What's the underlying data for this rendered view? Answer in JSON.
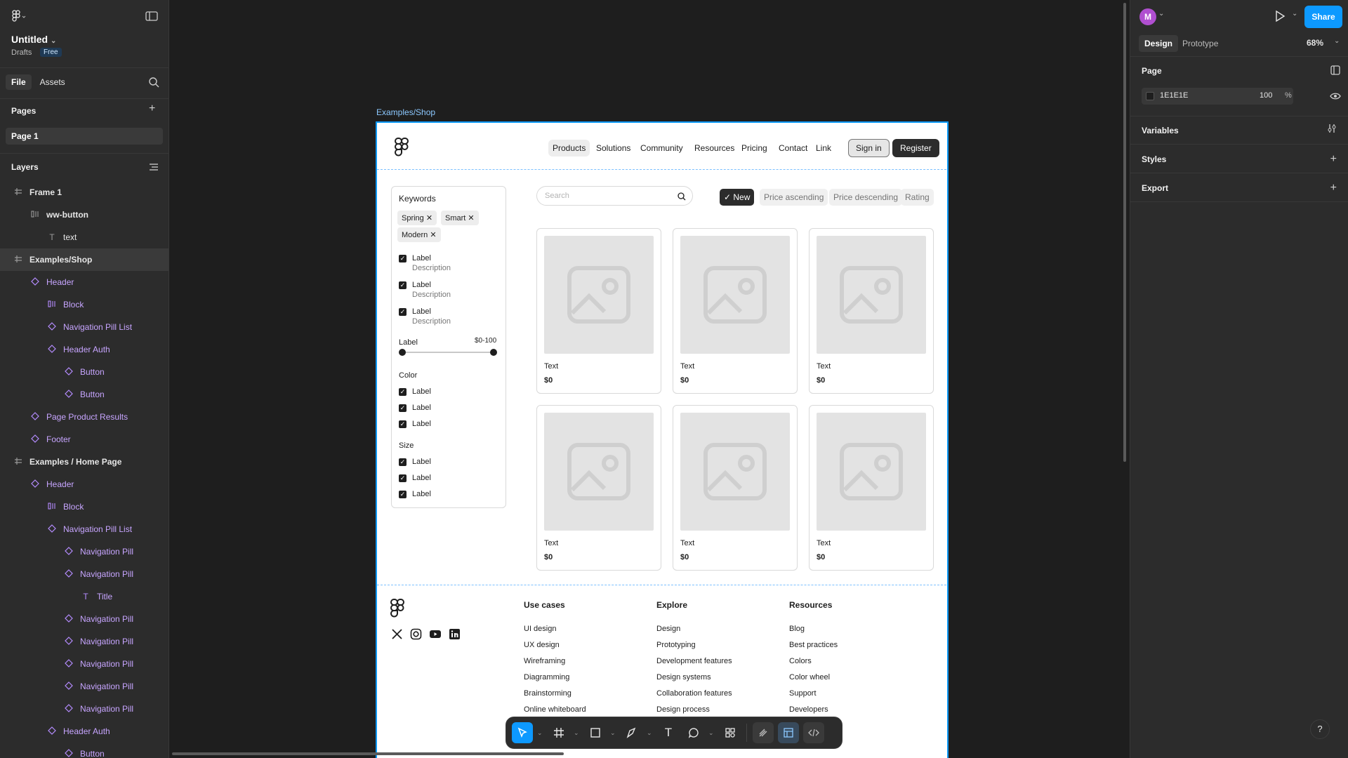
{
  "app": {
    "file_title": "Untitled",
    "drafts_label": "Drafts",
    "plan_badge": "Free",
    "panel_tabs": [
      "File",
      "Assets"
    ],
    "pages_header": "Pages",
    "current_page": "Page 1",
    "layers_header": "Layers"
  },
  "layers": [
    {
      "label": "Frame 1",
      "indent": 0,
      "icon": "frame-icon",
      "purple": false,
      "bold": true
    },
    {
      "label": "ww-button",
      "indent": 1,
      "icon": "auto-layout-icon",
      "purple": false,
      "bold": true
    },
    {
      "label": "text",
      "indent": 2,
      "icon": "text-icon",
      "purple": false,
      "bold": false
    },
    {
      "label": "Examples/Shop",
      "indent": 0,
      "icon": "frame-icon",
      "purple": false,
      "bold": true,
      "selected": true
    },
    {
      "label": "Header",
      "indent": 1,
      "icon": "instance-icon",
      "purple": true,
      "bold": false
    },
    {
      "label": "Block",
      "indent": 2,
      "icon": "auto-layout-icon",
      "purple": true,
      "bold": false
    },
    {
      "label": "Navigation Pill List",
      "indent": 2,
      "icon": "instance-icon",
      "purple": true,
      "bold": false
    },
    {
      "label": "Header Auth",
      "indent": 2,
      "icon": "instance-icon",
      "purple": true,
      "bold": false
    },
    {
      "label": "Button",
      "indent": 3,
      "icon": "instance-icon",
      "purple": true,
      "bold": false
    },
    {
      "label": "Button",
      "indent": 3,
      "icon": "instance-icon",
      "purple": true,
      "bold": false
    },
    {
      "label": "Page Product Results",
      "indent": 1,
      "icon": "instance-icon",
      "purple": true,
      "bold": false
    },
    {
      "label": "Footer",
      "indent": 1,
      "icon": "instance-icon",
      "purple": true,
      "bold": false
    },
    {
      "label": "Examples / Home Page",
      "indent": 0,
      "icon": "frame-icon",
      "purple": false,
      "bold": true
    },
    {
      "label": "Header",
      "indent": 1,
      "icon": "instance-icon",
      "purple": true,
      "bold": false
    },
    {
      "label": "Block",
      "indent": 2,
      "icon": "auto-layout-icon",
      "purple": true,
      "bold": false
    },
    {
      "label": "Navigation Pill List",
      "indent": 2,
      "icon": "instance-icon",
      "purple": true,
      "bold": false
    },
    {
      "label": "Navigation Pill",
      "indent": 3,
      "icon": "instance-icon",
      "purple": true,
      "bold": false
    },
    {
      "label": "Navigation Pill",
      "indent": 3,
      "icon": "instance-icon",
      "purple": true,
      "bold": false
    },
    {
      "label": "Title",
      "indent": 4,
      "icon": "text-icon",
      "purple": true,
      "bold": false
    },
    {
      "label": "Navigation Pill",
      "indent": 3,
      "icon": "instance-icon",
      "purple": true,
      "bold": false
    },
    {
      "label": "Navigation Pill",
      "indent": 3,
      "icon": "instance-icon",
      "purple": true,
      "bold": false
    },
    {
      "label": "Navigation Pill",
      "indent": 3,
      "icon": "instance-icon",
      "purple": true,
      "bold": false
    },
    {
      "label": "Navigation Pill",
      "indent": 3,
      "icon": "instance-icon",
      "purple": true,
      "bold": false
    },
    {
      "label": "Navigation Pill",
      "indent": 3,
      "icon": "instance-icon",
      "purple": true,
      "bold": false
    },
    {
      "label": "Header Auth",
      "indent": 2,
      "icon": "instance-icon",
      "purple": true,
      "bold": false
    },
    {
      "label": "Button",
      "indent": 3,
      "icon": "instance-icon",
      "purple": true,
      "bold": false
    }
  ],
  "right_panel": {
    "avatar_letter": "M",
    "share_label": "Share",
    "tabs": [
      "Design",
      "Prototype"
    ],
    "zoom": "68%",
    "page_section": "Page",
    "page_color_hex": "1E1E1E",
    "page_opacity": "100",
    "percent_sign": "%",
    "variables": "Variables",
    "styles": "Styles",
    "export": "Export"
  },
  "canvas": {
    "frame_label": "Examples/Shop",
    "nav": [
      "Products",
      "Solutions",
      "Community",
      "Resources",
      "Pricing",
      "Contact",
      "Link"
    ],
    "sign_in": "Sign in",
    "register": "Register",
    "filters": {
      "keywords_title": "Keywords",
      "tags": [
        "Spring",
        "Smart",
        "Modern"
      ],
      "checks": [
        {
          "label": "Label",
          "desc": "Description"
        },
        {
          "label": "Label",
          "desc": "Description"
        },
        {
          "label": "Label",
          "desc": "Description"
        }
      ],
      "range_label": "Label",
      "range_value": "$0-100",
      "color_title": "Color",
      "color_items": [
        "Label",
        "Label",
        "Label"
      ],
      "size_title": "Size",
      "size_items": [
        "Label",
        "Label",
        "Label"
      ]
    },
    "search_placeholder": "Search",
    "sort": [
      "New",
      "Price ascending",
      "Price descending",
      "Rating"
    ],
    "products": [
      {
        "title": "Text",
        "price": "$0"
      },
      {
        "title": "Text",
        "price": "$0"
      },
      {
        "title": "Text",
        "price": "$0"
      },
      {
        "title": "Text",
        "price": "$0"
      },
      {
        "title": "Text",
        "price": "$0"
      },
      {
        "title": "Text",
        "price": "$0"
      }
    ],
    "footer": {
      "cols": [
        {
          "title": "Use cases",
          "links": [
            "UI design",
            "UX design",
            "Wireframing",
            "Diagramming",
            "Brainstorming",
            "Online whiteboard"
          ]
        },
        {
          "title": "Explore",
          "links": [
            "Design",
            "Prototyping",
            "Development features",
            "Design systems",
            "Collaboration features",
            "Design process"
          ]
        },
        {
          "title": "Resources",
          "links": [
            "Blog",
            "Best practices",
            "Colors",
            "Color wheel",
            "Support",
            "Developers"
          ]
        }
      ]
    }
  },
  "help_label": "?"
}
